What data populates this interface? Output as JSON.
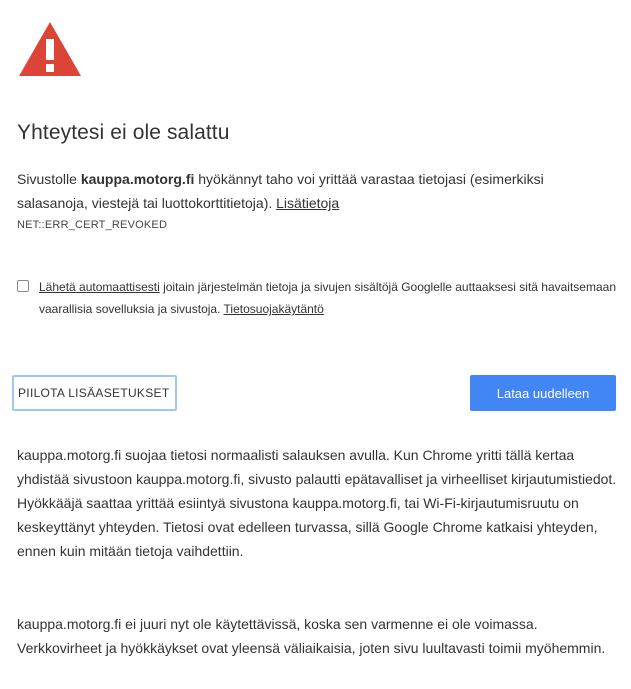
{
  "header": {
    "title": "Yhteytesi ei ole salattu"
  },
  "intro": {
    "text_before_domain": "Sivustolle ",
    "domain": "kauppa.motorg.fi",
    "text_after_domain": " hyökännyt taho voi yrittää varastaa tietojasi (esimerkiksi salasanoja, viestejä tai luottokorttitietoja). ",
    "learn_more_link": "Lisätietoja",
    "error_code": "NET::ERR_CERT_REVOKED"
  },
  "optin": {
    "checked": false,
    "link_text": "Lähetä automaattisesti",
    "text_middle": " joitain järjestelmän tietoja ja sivujen sisältöjä Googlelle auttaaksesi sitä havaitsemaan vaarallisia sovelluksia ja sivustoja. ",
    "privacy_link": "Tietosuojakäytäntö"
  },
  "buttons": {
    "hide_advanced": "PIILOTA LISÄASETUKSET",
    "reload": "Lataa uudelleen"
  },
  "details": {
    "paragraph1": "kauppa.motorg.fi suojaa tietosi normaalisti salauksen avulla. Kun Chrome yritti tällä kertaa yhdistää sivustoon kauppa.motorg.fi, sivusto palautti epätavalliset ja virheelliset kirjautumistiedot. Hyökkääjä saattaa yrittää esiintyä sivustona kauppa.motorg.fi, tai Wi-Fi-kirjautumisruutu on keskeyttänyt yhteyden. Tietosi ovat edelleen turvassa, sillä Google Chrome katkaisi yhteyden, ennen kuin mitään tietoja vaihdettiin.",
    "paragraph2": "kauppa.motorg.fi ei juuri nyt ole käytettävissä, koska sen varmenne ei ole voimassa. Verkkovirheet ja hyökkäykset ovat yleensä väliaikaisia, joten sivu luultavasti toimii myöhemmin."
  },
  "icons": {
    "warning": "warning-triangle-icon"
  },
  "colors": {
    "warning_red": "#db4437",
    "button_blue": "#4285f4",
    "focus_ring": "#9ec7f4",
    "text": "#333333"
  }
}
